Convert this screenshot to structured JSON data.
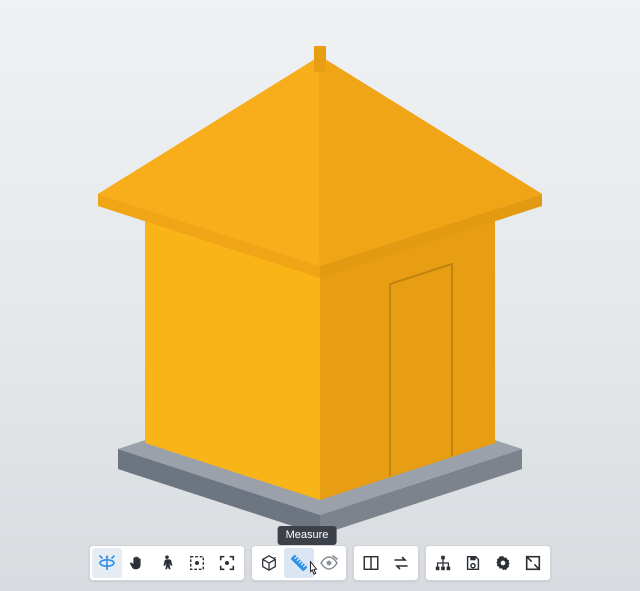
{
  "tooltip": {
    "measure": "Measure"
  },
  "model": {
    "colors": {
      "roof_light": "#f7ae1a",
      "roof_mid": "#f0a516",
      "roof_dark": "#e39a13",
      "wall_front": "#f9b517",
      "wall_side": "#e89e12",
      "top_face": "#fcc42a",
      "slab_top": "#9aa1ab",
      "slab_front": "#7c838d",
      "slab_side": "#6d7580",
      "door_line": "#c08411"
    }
  },
  "toolbar": {
    "groups": [
      {
        "id": "nav",
        "items": [
          {
            "id": "orbit",
            "icon": "orbit",
            "active": true,
            "accent": "#2f8fe8"
          },
          {
            "id": "pan",
            "icon": "hand"
          },
          {
            "id": "walk",
            "icon": "person"
          },
          {
            "id": "fit",
            "icon": "fit"
          },
          {
            "id": "focus",
            "icon": "focus"
          }
        ]
      },
      {
        "id": "inspect",
        "items": [
          {
            "id": "cube",
            "icon": "cube"
          },
          {
            "id": "measure",
            "icon": "ruler",
            "selected": true,
            "accent": "#2f8fe8",
            "tooltip": "measure"
          },
          {
            "id": "visibility",
            "icon": "eye"
          }
        ]
      },
      {
        "id": "view",
        "items": [
          {
            "id": "split",
            "icon": "split"
          },
          {
            "id": "undo-redo",
            "icon": "swap"
          }
        ]
      },
      {
        "id": "sys",
        "items": [
          {
            "id": "tree",
            "icon": "tree"
          },
          {
            "id": "save",
            "icon": "save"
          },
          {
            "id": "settings",
            "icon": "gear"
          },
          {
            "id": "fullscreen",
            "icon": "expand"
          }
        ]
      }
    ]
  }
}
